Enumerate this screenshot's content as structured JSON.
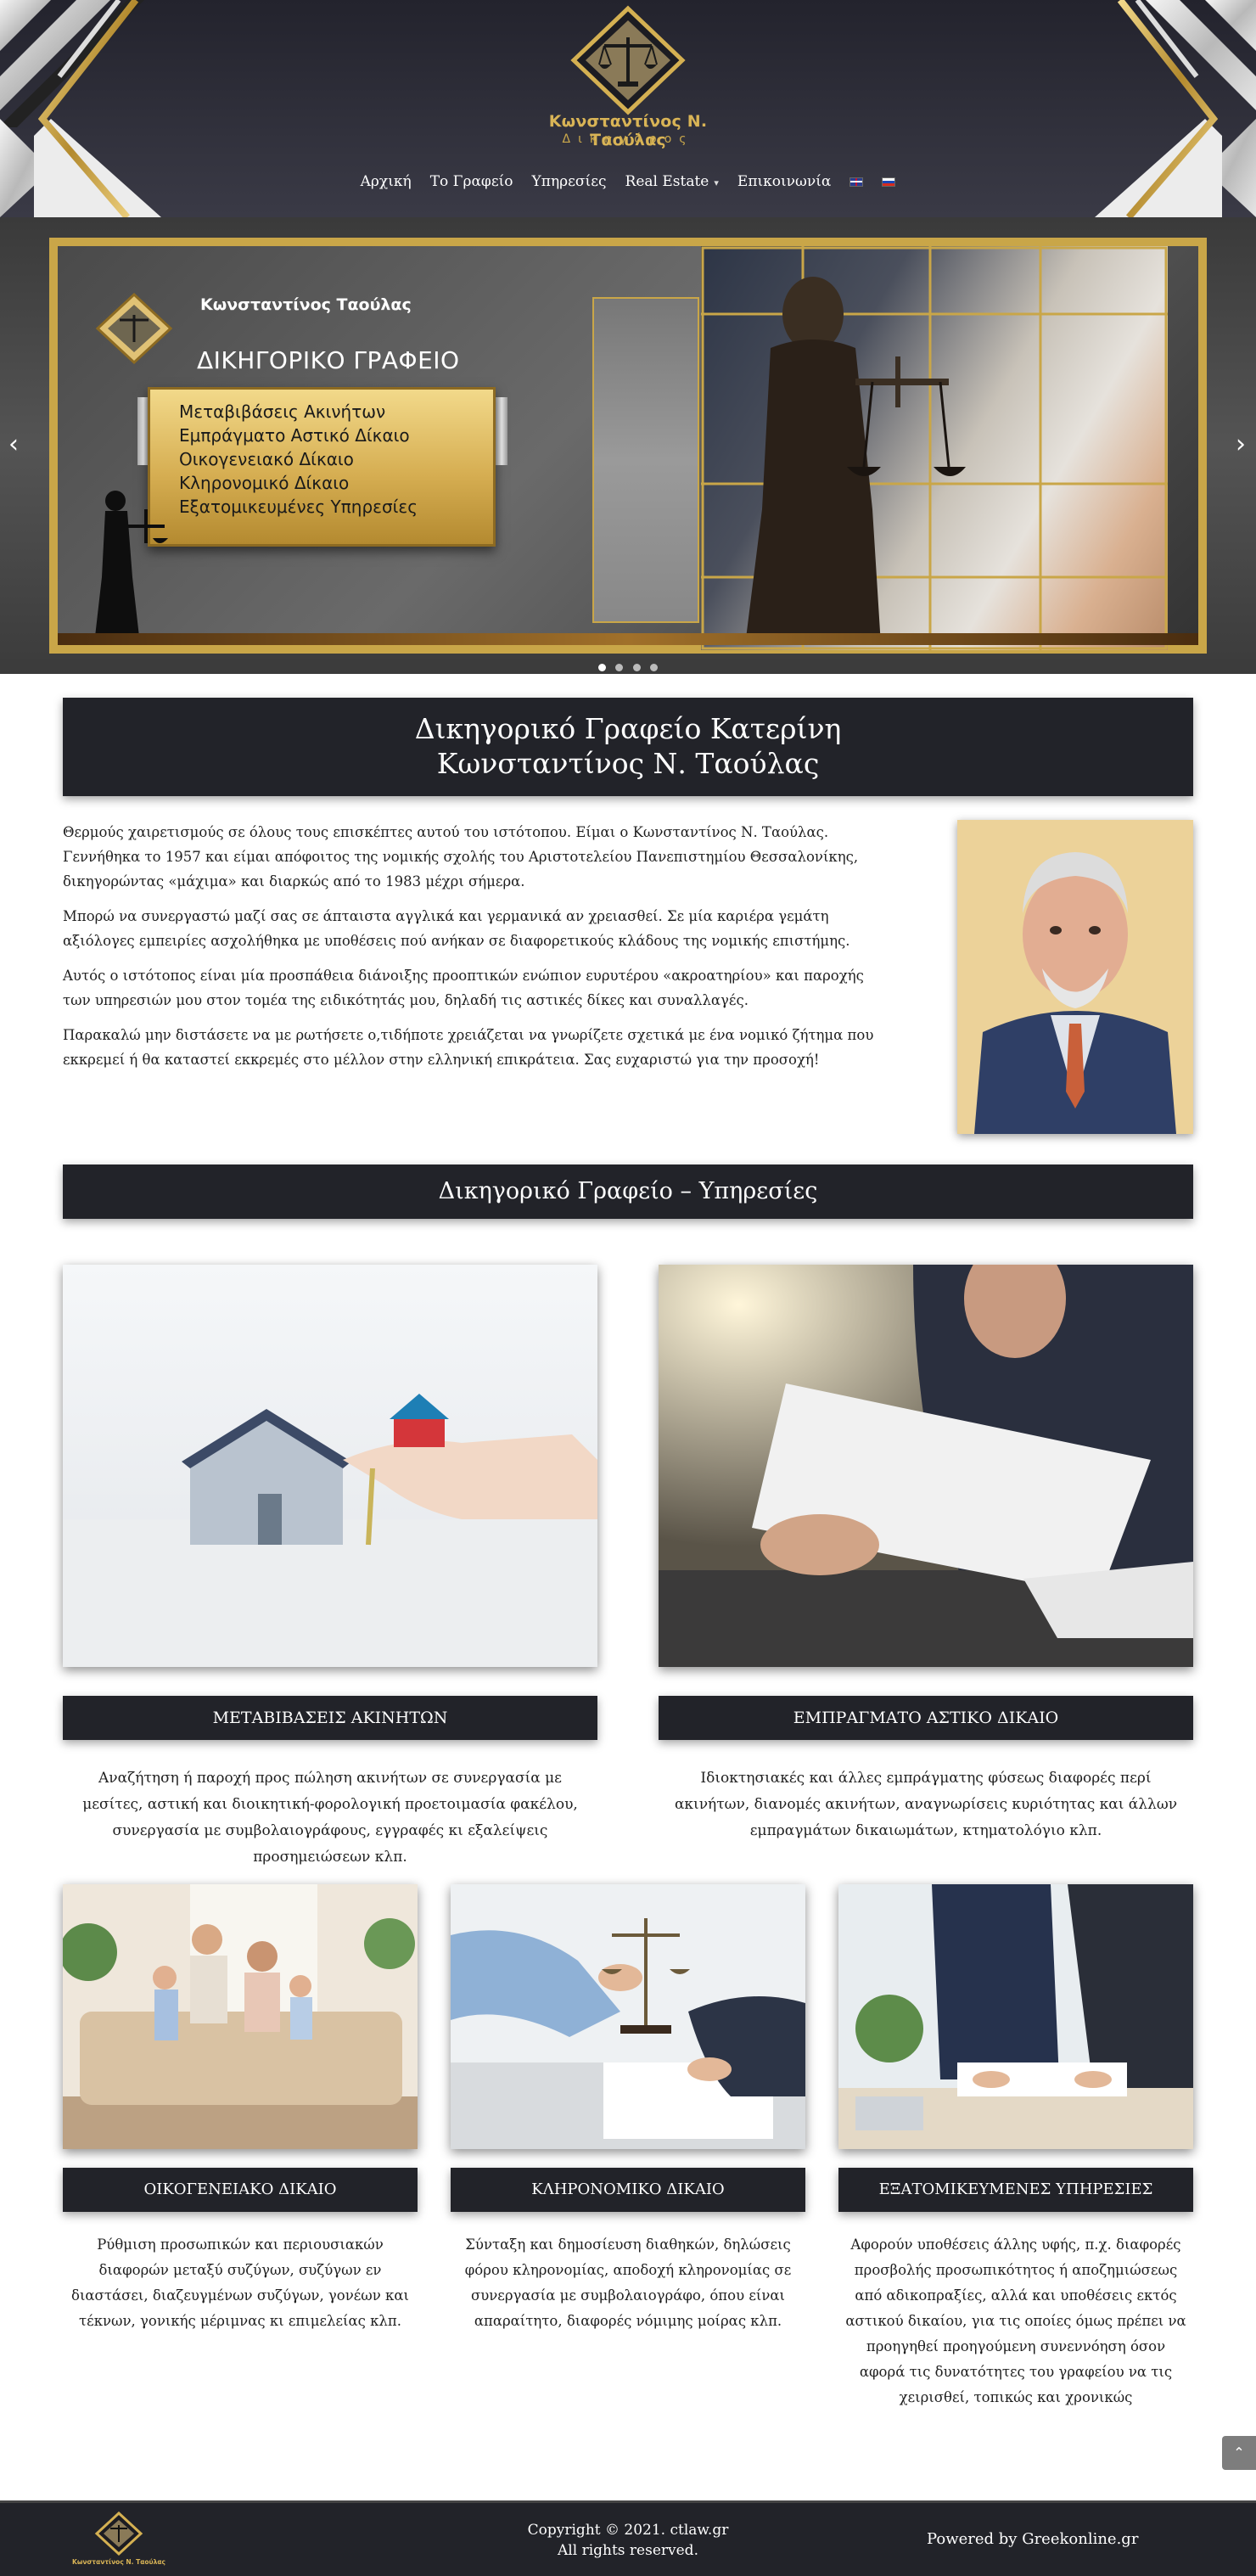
{
  "header": {
    "logo_name": "Κωνσταντίνος Ν. Ταούλας",
    "logo_sub": "Δικηγόρος",
    "nav": [
      {
        "label": "Αρχική"
      },
      {
        "label": "Το Γραφείο"
      },
      {
        "label": "Υπηρεσίες"
      },
      {
        "label": "Real Estate",
        "has_dropdown": true
      },
      {
        "label": "Επικοινωνία"
      }
    ],
    "languages": [
      "en-flag",
      "ru-flag"
    ]
  },
  "hero": {
    "slide_name": "Κωνσταντίνος Ταούλας",
    "slide_title": "ΔΙΚΗΓΟΡΙΚΟ ΓΡΑΦΕΙΟ",
    "slide_items": [
      "Μεταβιβάσεις Ακινήτων",
      "Εμπράγματο Αστικό Δίκαιο",
      "Οικογενειακό Δίκαιο",
      "Κληρονομικό Δίκαιο",
      "Εξατομικευμένες Υπηρεσίες"
    ],
    "arrow_left": "‹",
    "arrow_right": "›",
    "slide_count": 4,
    "active_slide": 1
  },
  "main": {
    "title_line1": "Δικηγορικό Γραφείο Κατερίνη",
    "title_line2": "Κωνσταντίνος Ν. Ταούλας",
    "intro": [
      "Θερμούς χαιρετισμούς σε όλους τους επισκέπτες αυτού του ιστότοπου. Είμαι ο Κωνσταντίνος Ν. Ταούλας. Γεννήθηκα το 1957 και είμαι απόφοιτος της νομικής σχολής του Αριστοτελείου Πανεπιστημίου Θεσσαλονίκης, δικηγορώντας «μάχιμα» και διαρκώς από το 1983 μέχρι σήμερα.",
      "Μπορώ να συνεργαστώ μαζί σας σε άπταιστα αγγλικά και γερμανικά αν χρειασθεί. Σε μία καριέρα γεμάτη αξιόλογες εμπειρίες ασχολήθηκα με υποθέσεις πού ανήκαν σε διαφορετικούς κλάδους της νομικής επιστήμης.",
      "Αυτός ο ιστότοπος είναι μία προσπάθεια διάνοιξης προοπτικών ενώπιον ευρυτέρου «ακροατηρίου» και παροχής των υπηρεσιών μου στον τομέα της ειδικότητάς μου, δηλαδή τις αστικές δίκες και συναλλαγές.",
      "Παρακαλώ μην διστάσετε να με ρωτήσετε ο,τιδήποτε χρειάζεται να γνωρίζετε σχετικά με ένα νομικό ζήτημα που εκκρεμεί ή θα καταστεί εκκρεμές στο μέλλον στην ελληνική επικράτεια. Σας ευχαριστώ για την προσοχή!"
    ],
    "services_title": "Δικηγορικό Γραφείο – Υπηρεσίες",
    "services": [
      {
        "title": "ΜΕΤΑΒΙΒΑΣΕΙΣ ΑΚΙΝΗΤΩΝ",
        "text": "Αναζήτηση ή παροχή προς πώληση ακινήτων σε συνεργασία με μεσίτες, αστική και διοικητική-φορολογική προετοιμασία φακέλου, συνεργασία με συμβολαιογράφους, εγγραφές κι εξαλείψεις προσημειώσεων κλπ."
      },
      {
        "title": "ΕΜΠΡΑΓΜΑΤΟ ΑΣΤΙΚΟ ΔΙΚΑΙΟ",
        "text": "Ιδιοκτησιακές και άλλες εμπράγματης φύσεως διαφορές περί ακινήτων, διανομές ακινήτων, αναγνωρίσεις κυριότητας και άλλων εμπραγμάτων δικαιωμάτων, κτηματολόγιο κλπ."
      },
      {
        "title": "ΟΙΚΟΓΕΝΕΙΑΚΟ ΔΙΚΑΙΟ",
        "text": "Ρύθμιση προσωπικών και περιουσιακών διαφορών μεταξύ συζύγων, συζύγων εν διαστάσει, διαζευγμένων συζύγων, γονέων και τέκνων, γονικής μέριμνας κι επιμελείας κλπ."
      },
      {
        "title": "ΚΛΗΡΟΝΟΜΙΚΟ ΔΙΚΑΙΟ",
        "text": "Σύνταξη και δημοσίευση διαθηκών, δηλώσεις φόρου κληρονομίας, αποδοχή κληρονομίας σε συνεργασία με συμβολαιογράφο, όπου είναι απαραίτητο, διαφορές νόμιμης μοίρας κλπ."
      },
      {
        "title": "ΕΞΑΤΟΜΙΚΕΥΜΕΝΕΣ ΥΠΗΡΕΣΙΕΣ",
        "text": "Αφορούν υποθέσεις άλλης υφής, π.χ. διαφορές προσβολής προσωπικότητος ή αποζημιώσεως από αδικοπραξίες, αλλά και υποθέσεις εκτός αστικού δικαίου, για τις οποίες όμως πρέπει να προηγηθεί προηγούμενη συνεννόηση όσον αφορά τις δυνατότητες του γραφείου να τις χειρισθεί, τοπικώς και χρονικώς"
      }
    ]
  },
  "scroll_top_icon": "chevron-up-icon",
  "footer": {
    "logo_name": "Κωνσταντίνος Ν. Ταούλας",
    "copyright": "Copyright © 2021. ctlaw.gr",
    "rights": "All rights reserved.",
    "powered": "Powered by Greekonline.gr"
  },
  "colors": {
    "dark_bar": "#222329",
    "header_bg": "#2b2b36",
    "gold": "#c9a648"
  }
}
